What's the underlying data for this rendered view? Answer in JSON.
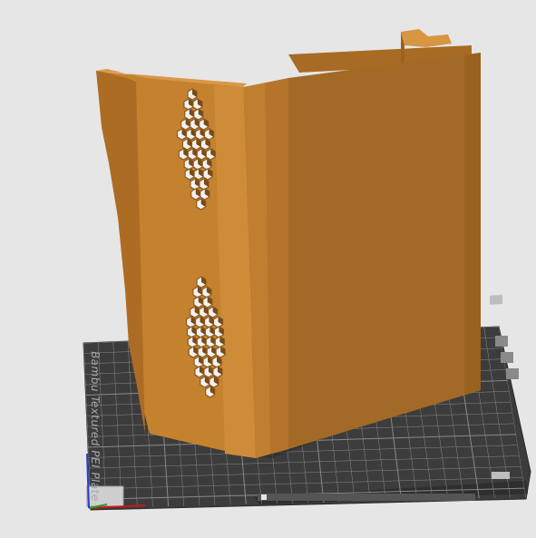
{
  "viewport": {
    "background": "#e6e6e6",
    "bed": {
      "color": "#3a3a3a",
      "grid_color": "#8a8a8a",
      "label": "Bambu Textured PEI Plate"
    },
    "model": {
      "color_front": "#b8762c",
      "color_side": "#c98a36",
      "color_dark": "#8c5a1e"
    },
    "axes": {
      "x_color": "#d01414",
      "y_color": "#2a9a2a",
      "z_color": "#2a3fd0"
    }
  }
}
